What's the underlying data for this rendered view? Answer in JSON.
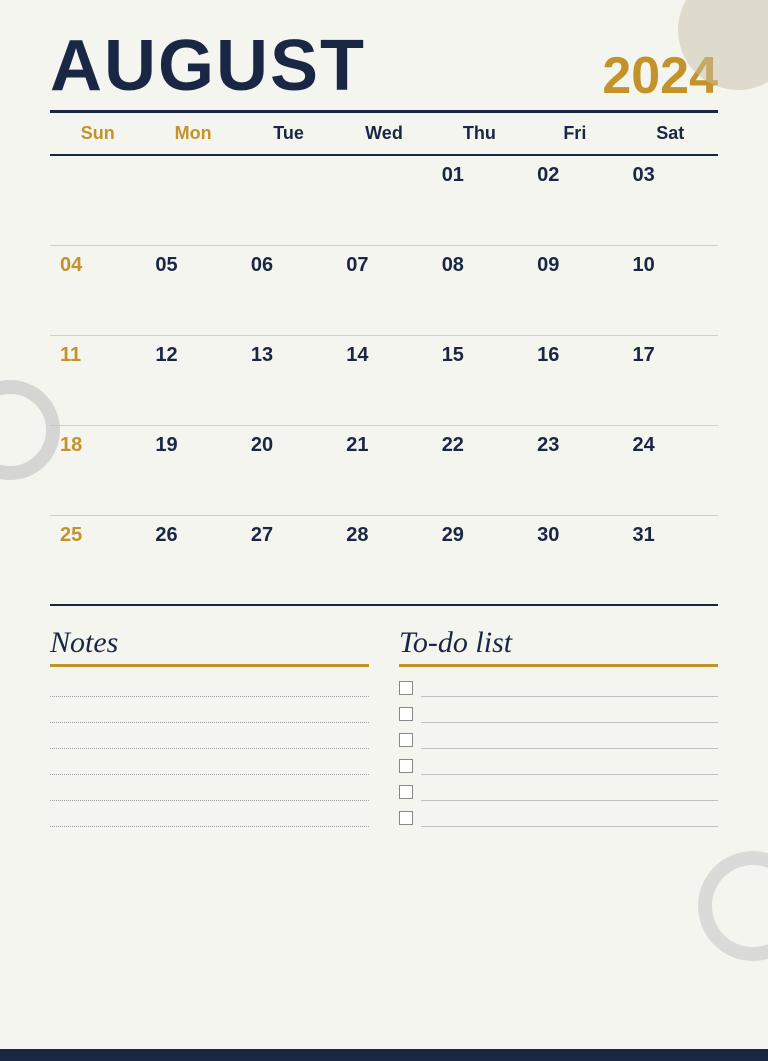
{
  "header": {
    "month": "AUGUST",
    "year": "2024"
  },
  "calendar": {
    "days_of_week": [
      {
        "label": "Sun",
        "class": "th-sun"
      },
      {
        "label": "Mon",
        "class": "th-mon"
      },
      {
        "label": "Tue",
        "class": "th-tue"
      },
      {
        "label": "Wed",
        "class": "th-wed"
      },
      {
        "label": "Thu",
        "class": "th-thu"
      },
      {
        "label": "Fri",
        "class": "th-fri"
      },
      {
        "label": "Sat",
        "class": "th-sat"
      }
    ],
    "weeks": [
      [
        {
          "day": "",
          "empty": true
        },
        {
          "day": "",
          "empty": true
        },
        {
          "day": "",
          "empty": true
        },
        {
          "day": "",
          "empty": true
        },
        {
          "day": "01",
          "sunday": false
        },
        {
          "day": "02",
          "sunday": false
        },
        {
          "day": "03",
          "sunday": false
        }
      ],
      [
        {
          "day": "04",
          "sunday": true
        },
        {
          "day": "05",
          "sunday": false
        },
        {
          "day": "06",
          "sunday": false
        },
        {
          "day": "07",
          "sunday": false
        },
        {
          "day": "08",
          "sunday": false
        },
        {
          "day": "09",
          "sunday": false
        },
        {
          "day": "10",
          "sunday": false
        }
      ],
      [
        {
          "day": "11",
          "sunday": true
        },
        {
          "day": "12",
          "sunday": false
        },
        {
          "day": "13",
          "sunday": false
        },
        {
          "day": "14",
          "sunday": false
        },
        {
          "day": "15",
          "sunday": false
        },
        {
          "day": "16",
          "sunday": false
        },
        {
          "day": "17",
          "sunday": false
        }
      ],
      [
        {
          "day": "18",
          "sunday": true
        },
        {
          "day": "19",
          "sunday": false
        },
        {
          "day": "20",
          "sunday": false
        },
        {
          "day": "21",
          "sunday": false
        },
        {
          "day": "22",
          "sunday": false
        },
        {
          "day": "23",
          "sunday": false
        },
        {
          "day": "24",
          "sunday": false
        }
      ],
      [
        {
          "day": "25",
          "sunday": true
        },
        {
          "day": "26",
          "sunday": false
        },
        {
          "day": "27",
          "sunday": false
        },
        {
          "day": "28",
          "sunday": false
        },
        {
          "day": "29",
          "sunday": false
        },
        {
          "day": "30",
          "sunday": false
        },
        {
          "day": "31",
          "sunday": false
        }
      ]
    ]
  },
  "notes": {
    "title": "Notes",
    "line_count": 6
  },
  "todo": {
    "title": "To-do list",
    "item_count": 6
  }
}
